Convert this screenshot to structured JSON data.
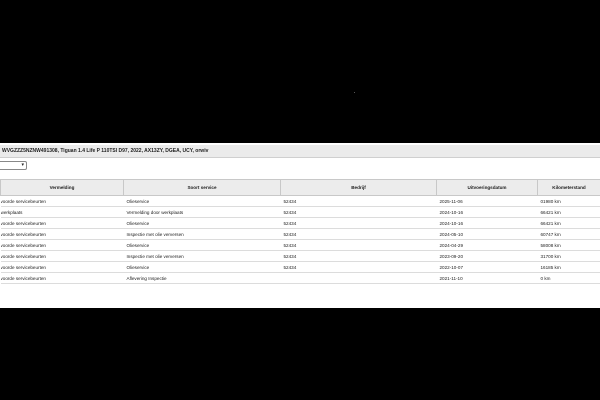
{
  "vehicle": {
    "title": "WVGZZZ5NZNW491308, Tiguan 1.4 Life P 110TSI D97, 2022, AX13ZY, DGEA, UCY, orwiv"
  },
  "filter": {
    "selected": ""
  },
  "table": {
    "columns": [
      "Vermelding",
      "Soort service",
      "Bedrijf",
      "Uitvoeringsdatum",
      "Kilometerstand"
    ],
    "rows": [
      [
        "voorde servicebeurten",
        "Olieservice",
        "52434",
        "2025-11-06",
        "01980 km"
      ],
      [
        "werkplaats",
        "Vermelding door werkplaats",
        "52434",
        "2024-10-16",
        "66421 km"
      ],
      [
        "voorde servicebeurten",
        "Olieservice",
        "52434",
        "2024-10-16",
        "66421 km"
      ],
      [
        "voorde servicebeurten",
        "Inspectie met olie verversen",
        "52434",
        "2024-05-10",
        "60747 km"
      ],
      [
        "voorde servicebeurten",
        "Olieservice",
        "52434",
        "2024-04-29",
        "58008 km"
      ],
      [
        "voorde servicebeurten",
        "Inspectie met olie verversen",
        "52434",
        "2023-09-20",
        "31700 km"
      ],
      [
        "voorde servicebeurten",
        "Olieservice",
        "52434",
        "2022-10-07",
        "16185 km"
      ],
      [
        "voorde servicebeurten",
        "Aflevering Inspectie",
        "",
        "2021-11-10",
        "0 km"
      ]
    ]
  }
}
